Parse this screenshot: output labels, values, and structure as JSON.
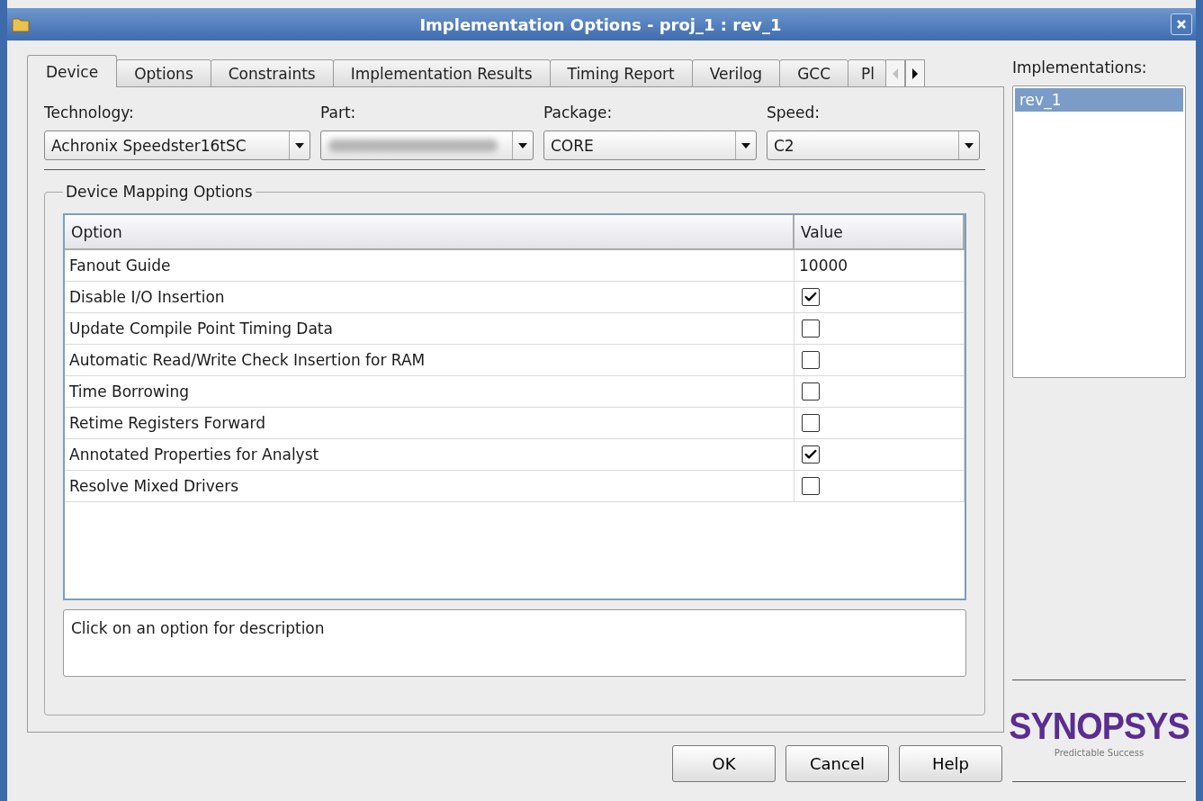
{
  "window": {
    "title": "Implementation Options  -  proj_1 : rev_1"
  },
  "tabs": [
    {
      "label": "Device",
      "selected": true
    },
    {
      "label": "Options",
      "selected": false
    },
    {
      "label": "Constraints",
      "selected": false
    },
    {
      "label": "Implementation Results",
      "selected": false
    },
    {
      "label": "Timing Report",
      "selected": false
    },
    {
      "label": "Verilog",
      "selected": false
    },
    {
      "label": "GCC",
      "selected": false
    },
    {
      "label": "Pl",
      "selected": false
    }
  ],
  "device": {
    "fields": [
      {
        "label": "Technology:",
        "value": "Achronix Speedster16tSC",
        "kind": "text"
      },
      {
        "label": "Part:",
        "kind": "blurred"
      },
      {
        "label": "Package:",
        "value": "CORE",
        "kind": "text"
      },
      {
        "label": "Speed:",
        "value": "C2",
        "kind": "text"
      }
    ]
  },
  "mapping": {
    "title": "Device Mapping Options",
    "columns": [
      "Option",
      "Value"
    ],
    "rows": [
      {
        "option": "Fanout Guide",
        "kind": "text",
        "value": "10000"
      },
      {
        "option": "Disable I/O Insertion",
        "kind": "checkbox",
        "checked": true
      },
      {
        "option": "Update Compile Point Timing Data",
        "kind": "checkbox",
        "checked": false
      },
      {
        "option": "Automatic Read/Write Check Insertion for RAM",
        "kind": "checkbox",
        "checked": false
      },
      {
        "option": "Time Borrowing",
        "kind": "checkbox",
        "checked": false
      },
      {
        "option": "Retime Registers Forward",
        "kind": "checkbox",
        "checked": false
      },
      {
        "option": "Annotated Properties for Analyst",
        "kind": "checkbox",
        "checked": true
      },
      {
        "option": "Resolve Mixed Drivers",
        "kind": "checkbox",
        "checked": false
      }
    ],
    "description": "Click on an option for description"
  },
  "implementations": {
    "label": "Implementations:",
    "items": [
      {
        "name": "rev_1",
        "selected": true
      }
    ]
  },
  "buttons": [
    "OK",
    "Cancel",
    "Help"
  ],
  "logo": {
    "name": "SYNOPSYS",
    "tagline": "Predictable Success"
  }
}
